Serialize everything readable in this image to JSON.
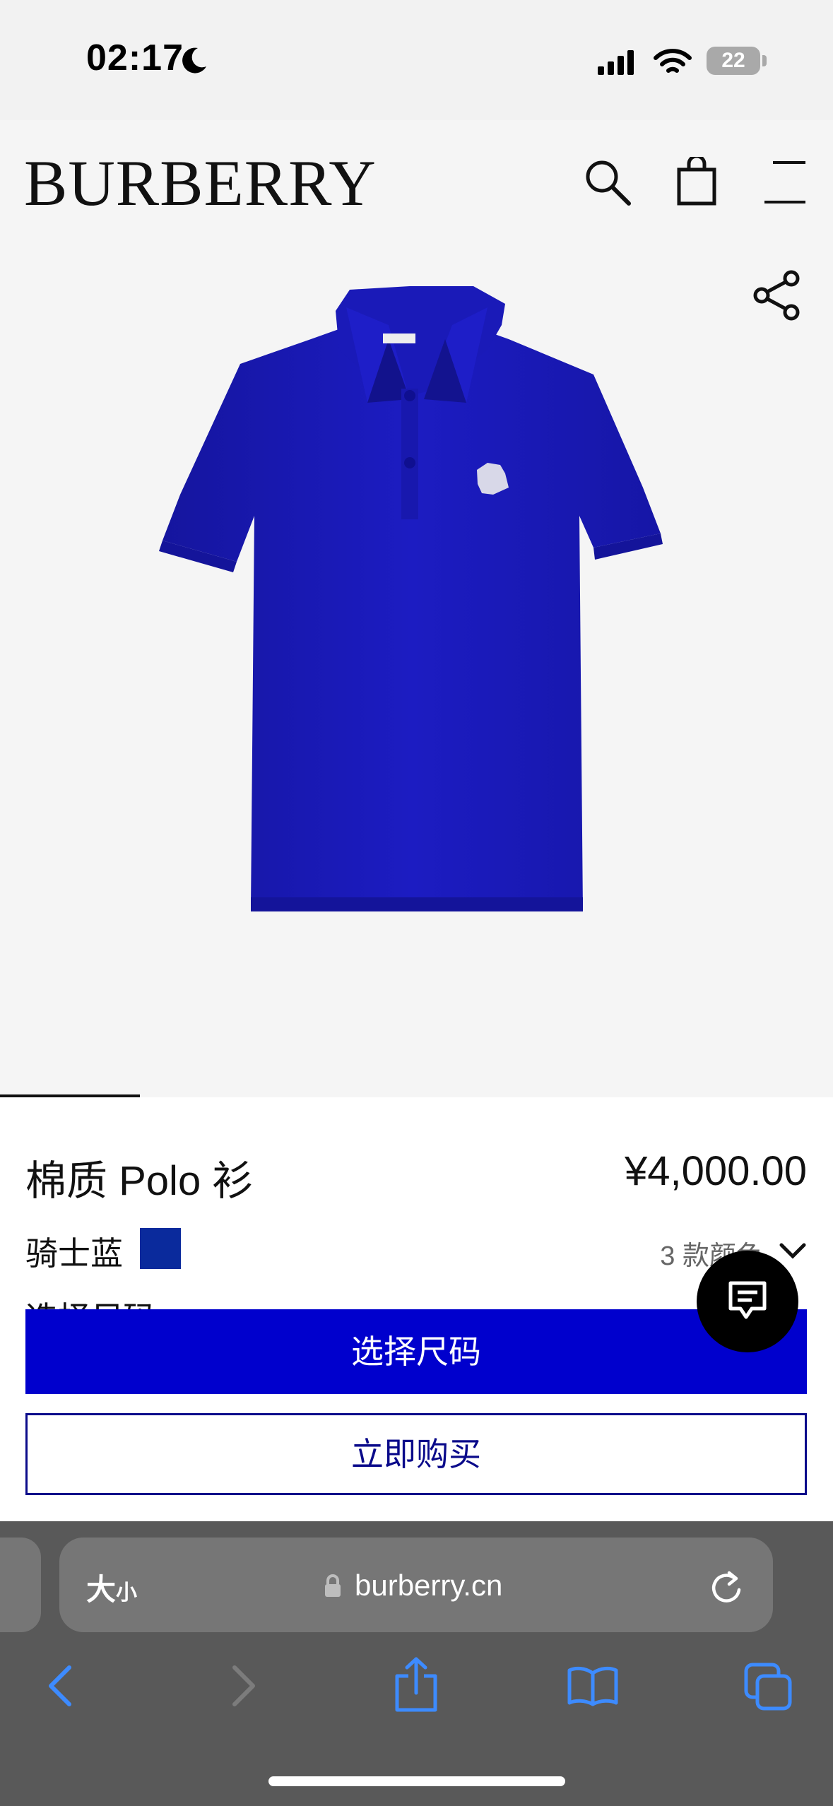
{
  "status_bar": {
    "time": "02:17",
    "battery": "22"
  },
  "header": {
    "brand": "BURBERRY"
  },
  "product": {
    "name": "棉质 Polo 衫",
    "price": "¥4,000.00",
    "color_name": "骑士蓝",
    "color_hex": "#0a2a9c",
    "color_count": "3 款颜色",
    "size_hint": "选择尺码"
  },
  "actions": {
    "select_size": "选择尺码",
    "buy_now": "立即购买"
  },
  "browser": {
    "text_size_label_big": "大",
    "text_size_label_small": "小",
    "url": "burberry.cn"
  },
  "colors": {
    "accent_blue": "#0000cd",
    "outline_navy": "#0a0a8a",
    "shirt_blue": "#1a1ab8",
    "ios_blue": "#3d8bff"
  },
  "icons": [
    "moon-icon",
    "signal-icon",
    "wifi-icon",
    "battery-icon",
    "search-icon",
    "shopping-bag-icon",
    "menu-icon",
    "share-icon",
    "chat-icon",
    "lock-icon",
    "reload-icon",
    "back-icon",
    "forward-icon",
    "share-sheet-icon",
    "bookmarks-icon",
    "tabs-icon"
  ]
}
